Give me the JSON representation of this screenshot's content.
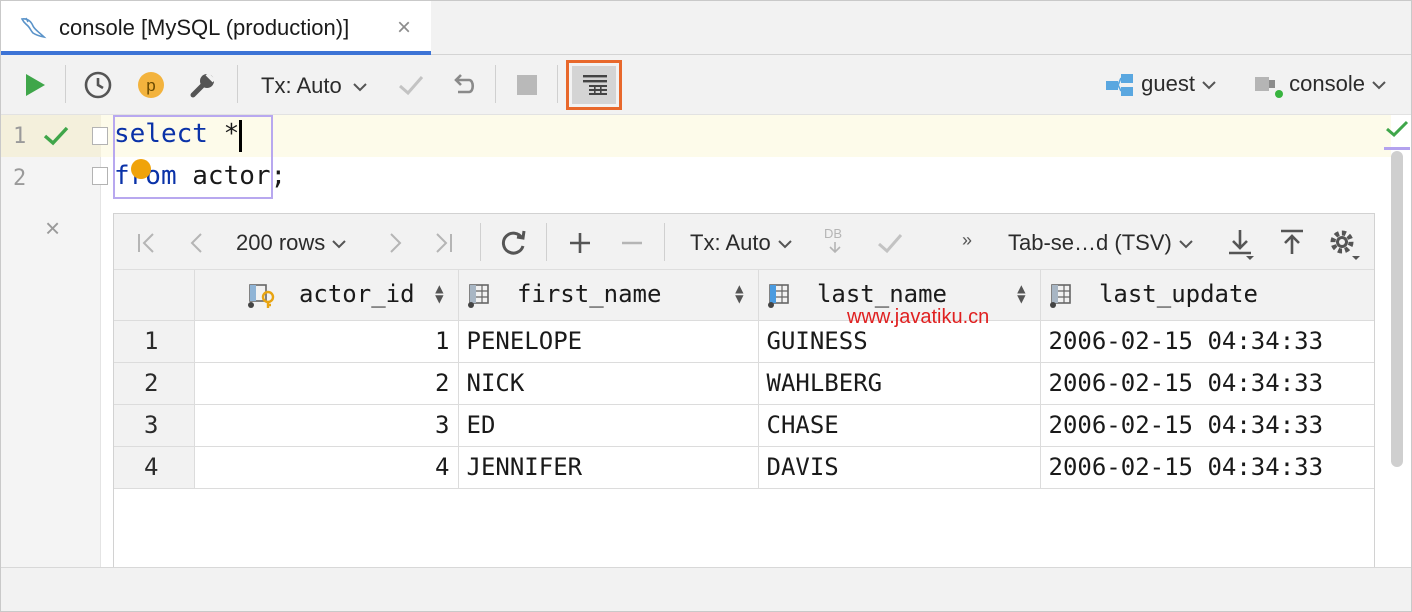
{
  "tab": {
    "title": "console [MySQL (production)]",
    "close": "×",
    "icon": "mysql-dolphin-icon"
  },
  "toolbar": {
    "tx_mode": "Tx: Auto",
    "user_label": "guest",
    "session_label": "console",
    "icons": [
      "run-icon",
      "history-icon",
      "profile-p-icon",
      "settings-wrench-icon",
      "commit-icon",
      "rollback-icon",
      "stop-icon",
      "in-editor-results-icon"
    ]
  },
  "editor": {
    "line_numbers": [
      "1",
      "2"
    ],
    "line1_keyword": "select",
    "line1_rest": " *",
    "line2_keyword": "from",
    "line2_rest": " actor;",
    "close_mark": "×"
  },
  "results": {
    "rows_label": "200 rows",
    "tx_mode": "Tx: Auto",
    "db_badge": "DB",
    "more": "»",
    "export_format": "Tab-se…d (TSV)",
    "columns": [
      "actor_id",
      "first_name",
      "last_name",
      "last_update"
    ],
    "rows": [
      {
        "n": "1",
        "actor_id": "1",
        "first_name": "PENELOPE",
        "last_name": "GUINESS",
        "last_update": "2006-02-15 04:34:33"
      },
      {
        "n": "2",
        "actor_id": "2",
        "first_name": "NICK",
        "last_name": "WAHLBERG",
        "last_update": "2006-02-15 04:34:33"
      },
      {
        "n": "3",
        "actor_id": "3",
        "first_name": "ED",
        "last_name": "CHASE",
        "last_update": "2006-02-15 04:34:33"
      },
      {
        "n": "4",
        "actor_id": "4",
        "first_name": "JENNIFER",
        "last_name": "DAVIS",
        "last_update": "2006-02-15 04:34:33"
      }
    ]
  },
  "watermark": "www.javatiku.cn",
  "colors": {
    "accent_tab": "#3d74d6",
    "highlight": "#e8682b",
    "keyword": "#0a32a8",
    "run_green": "#3fa64a",
    "check_green": "#3fa64a"
  }
}
